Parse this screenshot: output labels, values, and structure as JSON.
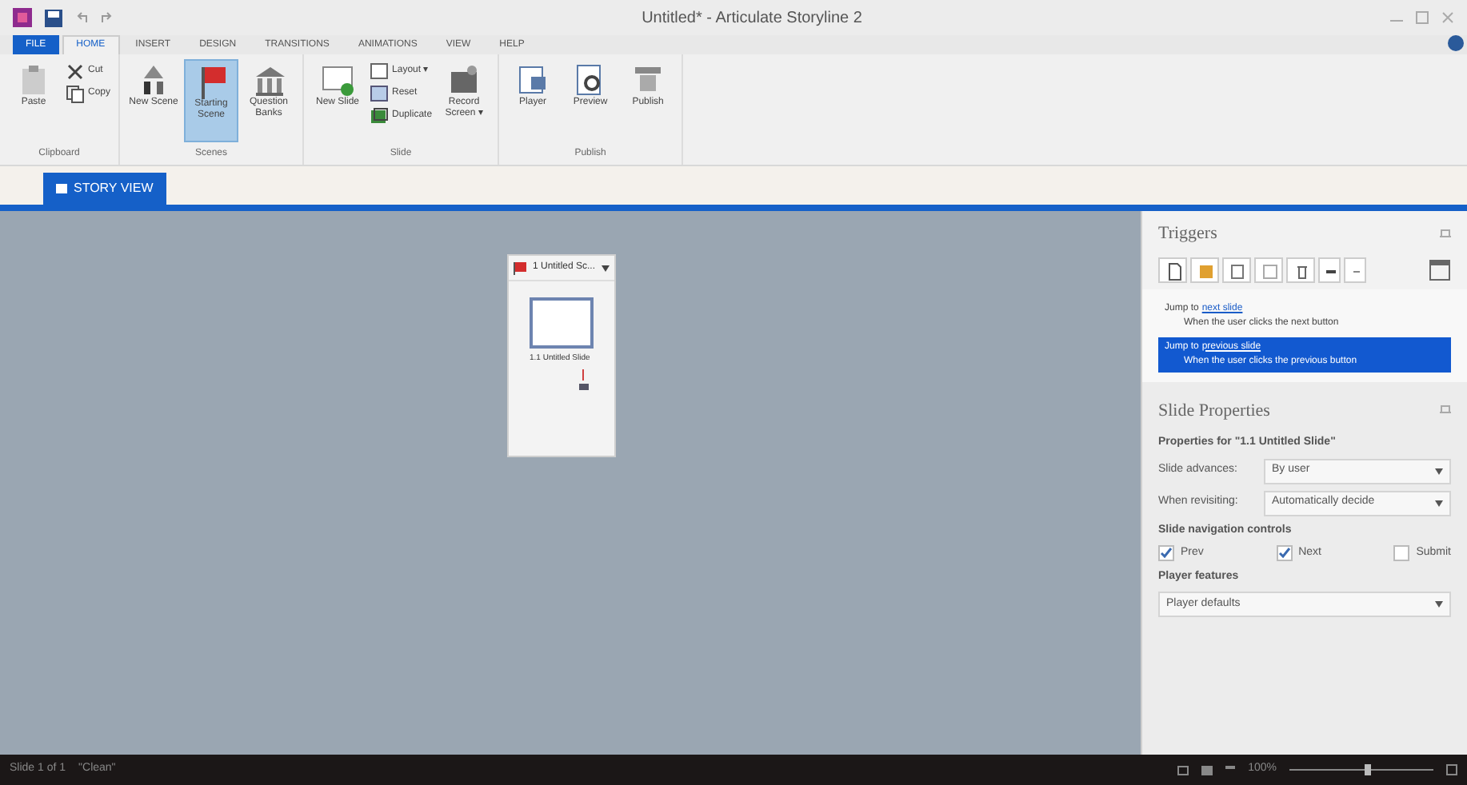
{
  "window": {
    "title": "Untitled* - Articulate Storyline 2"
  },
  "tabs": [
    {
      "label": "FILE",
      "kind": "file",
      "selected": false
    },
    {
      "label": "HOME",
      "kind": "tab",
      "selected": true
    },
    {
      "label": "INSERT",
      "kind": "tab",
      "selected": false
    },
    {
      "label": "DESIGN",
      "kind": "tab",
      "selected": false
    },
    {
      "label": "TRANSITIONS",
      "kind": "tab",
      "selected": false
    },
    {
      "label": "ANIMATIONS",
      "kind": "tab",
      "selected": false
    },
    {
      "label": "VIEW",
      "kind": "tab",
      "selected": false
    },
    {
      "label": "HELP",
      "kind": "tab",
      "selected": false
    }
  ],
  "ribbon": {
    "groups": [
      {
        "label": "Clipboard",
        "buttons": [
          {
            "kind": "large",
            "label": "Paste",
            "selected": false
          },
          {
            "kind": "stack",
            "items": [
              {
                "label": "Cut"
              },
              {
                "label": "Copy"
              }
            ]
          }
        ]
      },
      {
        "label": "Scenes",
        "buttons": [
          {
            "kind": "large",
            "label": "New Scene",
            "selected": false
          },
          {
            "kind": "large",
            "label": "Starting Scene",
            "selected": true
          },
          {
            "kind": "large",
            "label": "Question Banks",
            "selected": false
          }
        ]
      },
      {
        "label": "Slide",
        "buttons": [
          {
            "kind": "large",
            "label": "New Slide",
            "selected": false
          },
          {
            "kind": "stack",
            "items": [
              {
                "label": "Layout ▾"
              },
              {
                "label": "Reset"
              },
              {
                "label": "Duplicate"
              }
            ]
          },
          {
            "kind": "large",
            "label": "Record Screen ▾",
            "selected": false
          }
        ]
      },
      {
        "label": "Publish",
        "buttons": [
          {
            "kind": "large",
            "label": "Player",
            "selected": false
          },
          {
            "kind": "large",
            "label": "Preview",
            "selected": false
          },
          {
            "kind": "large",
            "label": "Publish",
            "selected": false
          }
        ]
      }
    ]
  },
  "view_tab": {
    "label": "STORY VIEW"
  },
  "scene_card": {
    "title": "1 Untitled Sc...",
    "slide_label": "1.1 Untitled Slide"
  },
  "triggers": {
    "title": "Triggers",
    "items": [
      {
        "action": "Jump to",
        "link": "next slide",
        "condition": "When the user clicks the next button",
        "selected": false
      },
      {
        "action": "Jump to",
        "link": "previous slide",
        "condition": "When the user clicks the previous button",
        "selected": true
      }
    ]
  },
  "slide_properties": {
    "title": "Slide Properties",
    "subtitle": "Properties for \"1.1 Untitled Slide\"",
    "fields": [
      {
        "label": "Slide advances:",
        "value": "By user"
      },
      {
        "label": "When revisiting:",
        "value": "Automatically decide"
      }
    ],
    "nav_heading": "Slide navigation controls",
    "nav_controls": [
      {
        "label": "Prev",
        "checked": true
      },
      {
        "label": "Next",
        "checked": true
      },
      {
        "label": "Submit",
        "checked": false
      }
    ],
    "player_heading": "Player features",
    "player_value": "Player defaults"
  },
  "status_bar": {
    "slide_info": "Slide 1 of 1",
    "theme": "\"Clean\"",
    "zoom": "100%",
    "zoom_level": {
      "level": 0.55
    }
  }
}
